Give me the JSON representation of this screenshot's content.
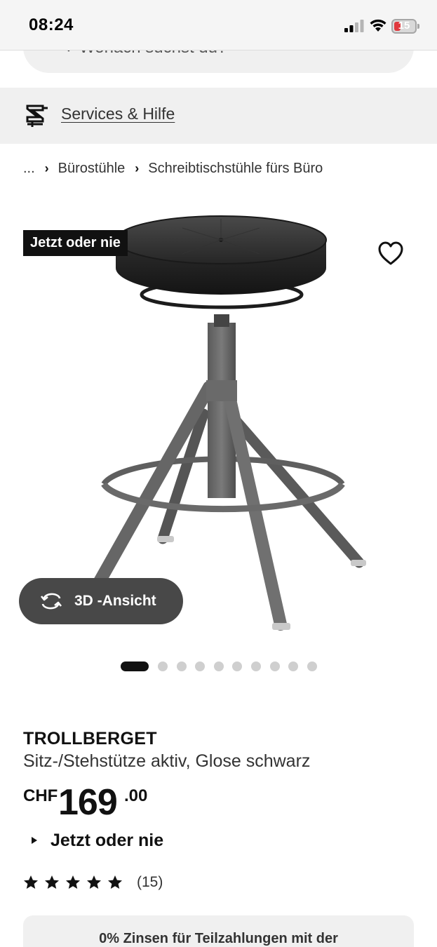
{
  "status_bar": {
    "time": "08:24",
    "battery_level": "15",
    "icons": [
      "cellular-signal-icon",
      "wifi-icon",
      "battery-icon"
    ]
  },
  "search": {
    "placeholder": "Wonach suchst du?",
    "icon": "search-icon"
  },
  "services": {
    "label": "Services & Hilfe",
    "icon": "service-tools-icon"
  },
  "breadcrumb": {
    "items": [
      "...",
      "Bürostühle",
      "Schreibtischstühle fürs Büro"
    ]
  },
  "gallery": {
    "badge": "Jetzt oder nie",
    "view3d_label": "3D -Ansicht",
    "image_count": 10,
    "active_index": 0,
    "favorite_icon": "heart-outline-icon",
    "view3d_icon": "rotate-arrows-icon"
  },
  "product": {
    "name": "TROLLBERGET",
    "description": "Sitz-/Stehstütze aktiv, Glose schwarz",
    "price": {
      "currency": "CHF",
      "integer": "169",
      "decimals": ".00"
    },
    "deal_label": "Jetzt oder nie",
    "rating": {
      "stars": 5,
      "count": "(15)"
    }
  },
  "financing": {
    "text": "0% Zinsen für Teilzahlungen mit der"
  },
  "colors": {
    "background": "#ffffff",
    "surface_grey": "#f0f0f0",
    "text_primary": "#111111",
    "badge_bg": "#111111",
    "button_dark": "#484848",
    "dot_inactive": "#cfcfcf",
    "battery_low": "#e0393e"
  }
}
